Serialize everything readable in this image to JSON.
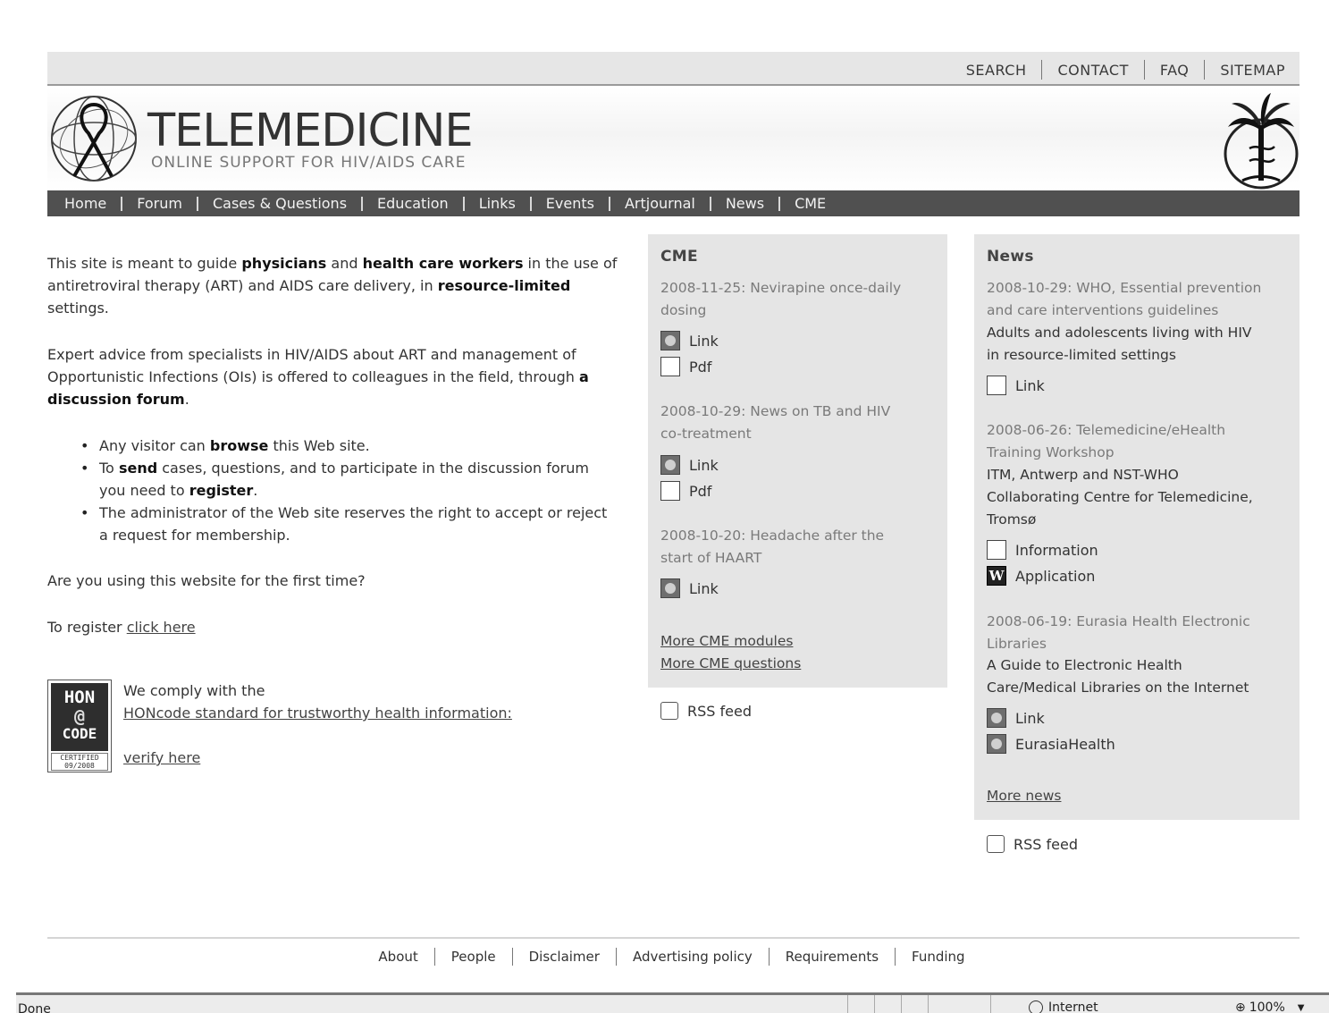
{
  "top_links": [
    "SEARCH",
    "CONTACT",
    "FAQ",
    "SITEMAP"
  ],
  "header": {
    "title": "TELEMEDICINE",
    "subtitle": "ONLINE SUPPORT FOR HIV/AIDS CARE"
  },
  "nav": [
    "Home",
    "Forum",
    "Cases & Questions",
    "Education",
    "Links",
    "Events",
    "Artjournal",
    "News",
    "CME"
  ],
  "intro": {
    "p1": [
      "This site is meant to guide ",
      "physicians",
      " and ",
      "health care workers",
      " in the use of antiretroviral therapy (ART) and AIDS care delivery, in ",
      "resource-limited",
      " settings."
    ],
    "p2": [
      "Expert advice from specialists in HIV/AIDS about ART and management of Opportunistic Infections (OIs) is offered to colleagues in the field, through ",
      "a discussion forum",
      "."
    ],
    "bullet1": [
      "Any visitor can ",
      "browse",
      " this Web site."
    ],
    "bullet2": [
      "To ",
      "send",
      " cases, questions, and to participate in the discussion forum you need to ",
      "register",
      "."
    ],
    "bullet3": "The administrator of the Web site reserves the right to accept or reject a request for membership.",
    "first_time": "Are you using this website for the first time?",
    "register_prefix": "To register ",
    "register_link": "click here"
  },
  "hon": {
    "badge_l1": "HON",
    "badge_l2": "@",
    "badge_l3": "CODE",
    "cert_l1": "CERTIFIED",
    "cert_l2": "09/2008",
    "comply": "We comply with the",
    "standard_link": "HONcode standard for trustworthy health information:",
    "verify_link": "verify here"
  },
  "cme": {
    "title": "CME",
    "items": [
      {
        "date_l1": "2008-11-25: Nevirapine once-daily",
        "date_l2": "dosing",
        "links": [
          "Link",
          "Pdf"
        ]
      },
      {
        "date_l1": "2008-10-29: News on TB and HIV",
        "date_l2": "co-treatment",
        "links": [
          "Link",
          "Pdf"
        ]
      },
      {
        "date_l1": "2008-10-20: Headache after the",
        "date_l2": "start of HAART",
        "links": [
          "Link"
        ]
      }
    ],
    "more_modules": "More CME modules",
    "more_questions": "More CME questions",
    "rss": "RSS feed"
  },
  "news": {
    "title": "News",
    "items": [
      {
        "date_l1": "2008-10-29: WHO, Essential prevention",
        "date_l2": "and care interventions guidelines",
        "desc_l1": "Adults and adolescents living with HIV",
        "desc_l2": "in resource-limited settings",
        "links": [
          "Link"
        ]
      },
      {
        "date_l1": "2008-06-26: Telemedicine/eHealth",
        "date_l2": "Training Workshop",
        "desc_l1": "ITM, Antwerp and NST-WHO",
        "desc_l2": "Collaborating Centre for Telemedicine,",
        "desc_l3": "Tromsø",
        "links": [
          "Information",
          "Application"
        ]
      },
      {
        "date_l1": "2008-06-19: Eurasia Health Electronic",
        "date_l2": "Libraries",
        "desc_l1": "A Guide to Electronic Health",
        "desc_l2": "Care/Medical Libraries on the Internet",
        "links": [
          "Link",
          "EurasiaHealth"
        ]
      }
    ],
    "more": "More news",
    "rss": "RSS feed"
  },
  "footer": [
    "About",
    "People",
    "Disclaimer",
    "Advertising policy",
    "Requirements",
    "Funding"
  ],
  "statusbar": {
    "status": "Done",
    "zone": "Internet",
    "zoom": "100%"
  }
}
